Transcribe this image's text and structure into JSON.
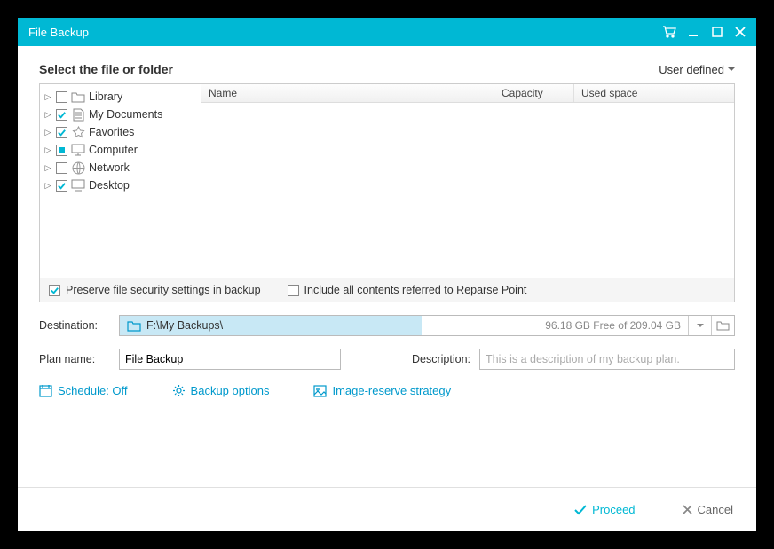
{
  "titlebar": {
    "title": "File Backup"
  },
  "heading": "Select the file or folder",
  "scope_dropdown": "User defined",
  "tree": [
    {
      "label": "Library",
      "checked": "unchecked",
      "icon": "folder"
    },
    {
      "label": "My Documents",
      "checked": "checked",
      "icon": "document"
    },
    {
      "label": "Favorites",
      "checked": "checked",
      "icon": "star"
    },
    {
      "label": "Computer",
      "checked": "partial",
      "icon": "monitor"
    },
    {
      "label": "Network",
      "checked": "unchecked",
      "icon": "globe"
    },
    {
      "label": "Desktop",
      "checked": "checked",
      "icon": "desktop"
    }
  ],
  "grid_headers": {
    "name": "Name",
    "capacity": "Capacity",
    "used": "Used space"
  },
  "options": {
    "preserve_security": {
      "label": "Preserve file security settings in backup",
      "checked": true
    },
    "include_reparse": {
      "label": "Include all contents referred to Reparse Point",
      "checked": false
    }
  },
  "destination": {
    "label": "Destination:",
    "path": "F:\\My Backups\\",
    "free_text": "96.18 GB Free of 209.04 GB"
  },
  "plan": {
    "label": "Plan name:",
    "value": "File Backup"
  },
  "description": {
    "label": "Description:",
    "placeholder": "This is a description of my backup plan."
  },
  "links": {
    "schedule": "Schedule: Off",
    "options": "Backup options",
    "image_reserve": "Image-reserve strategy"
  },
  "footer": {
    "proceed": "Proceed",
    "cancel": "Cancel"
  }
}
